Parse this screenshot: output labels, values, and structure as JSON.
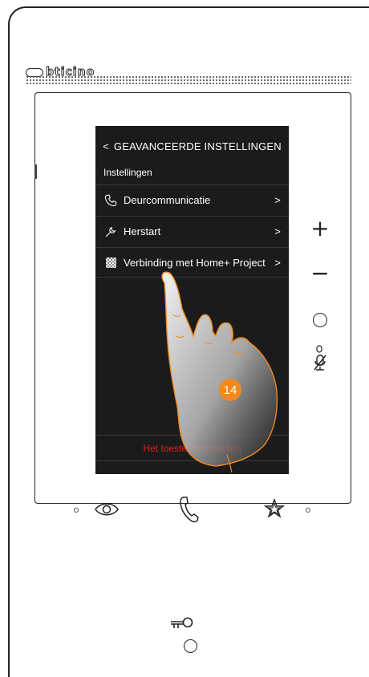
{
  "brand": {
    "logo_text": "bticino"
  },
  "screen": {
    "header": {
      "back_icon": "chevron-left-icon",
      "title": "GEAVANCEERDE INSTELLINGEN"
    },
    "section_label": "Instellingen",
    "items": [
      {
        "icon": "phone-handset-icon",
        "label": "Deurcommunicatie"
      },
      {
        "icon": "wrench-icon",
        "label": "Herstart"
      },
      {
        "icon": "qr-code-icon",
        "label": "Verbinding met Home+ Project"
      }
    ],
    "reset_label": "Het toestel herinstellen",
    "step_badge": "14"
  },
  "side_buttons": [
    "plus-icon",
    "minus-icon",
    "circle-button-icon",
    "mic-mute-icon"
  ],
  "bottom_buttons": [
    "eye-icon",
    "phone-handset-icon",
    "star-icon",
    "key-icon"
  ],
  "colors": {
    "screen_bg": "#1b1b1b",
    "reset_text": "#e02020",
    "badge": "#f08a1c"
  }
}
